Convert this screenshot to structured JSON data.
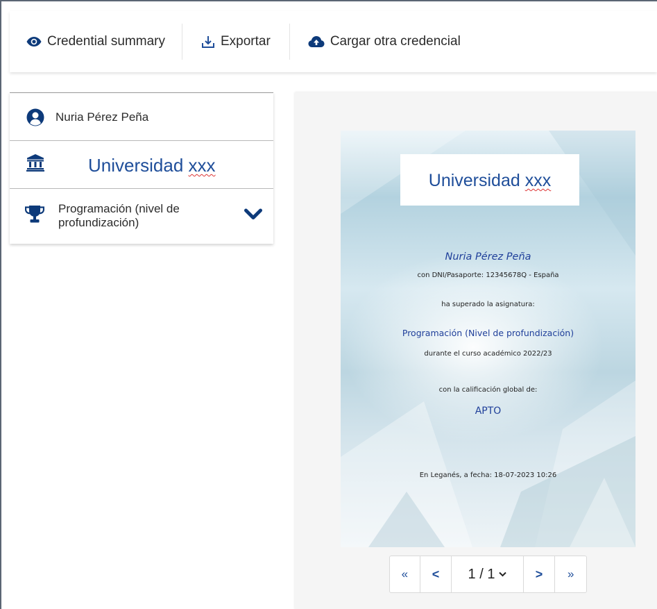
{
  "toolbar": {
    "summary_label": "Credential summary",
    "export_label": "Exportar",
    "upload_label": "Cargar otra credencial"
  },
  "sidebar": {
    "person_name": "Nuria Pérez Peña",
    "university_name": "Universidad",
    "university_suffix": "xxx",
    "course_name": "Programación (nivel de profundización)"
  },
  "certificate": {
    "title": "Universidad",
    "title_suffix": "xxx",
    "name": "Nuria Pérez Peña",
    "dni_line": "con DNI/Pasaporte: 12345678Q - España",
    "passed_line": "ha superado la asignatura:",
    "course": "Programación (Nivel de profundización)",
    "year_line": "durante el curso académico 2022/23",
    "grade_intro": "con la calificación global de:",
    "grade": "APTO",
    "date_line": "En Leganés, a fecha: 18-07-2023 10:26"
  },
  "pager": {
    "first": "«",
    "prev": "<",
    "page": "1 / 1",
    "next": ">",
    "last": "»"
  },
  "colors": {
    "accent": "#1f4e9a",
    "icon": "#0d3a7a"
  },
  "icons": [
    "eye-icon",
    "download-icon",
    "cloud-upload-icon",
    "user-circle-icon",
    "university-icon",
    "trophy-icon",
    "chevron-down-icon"
  ]
}
